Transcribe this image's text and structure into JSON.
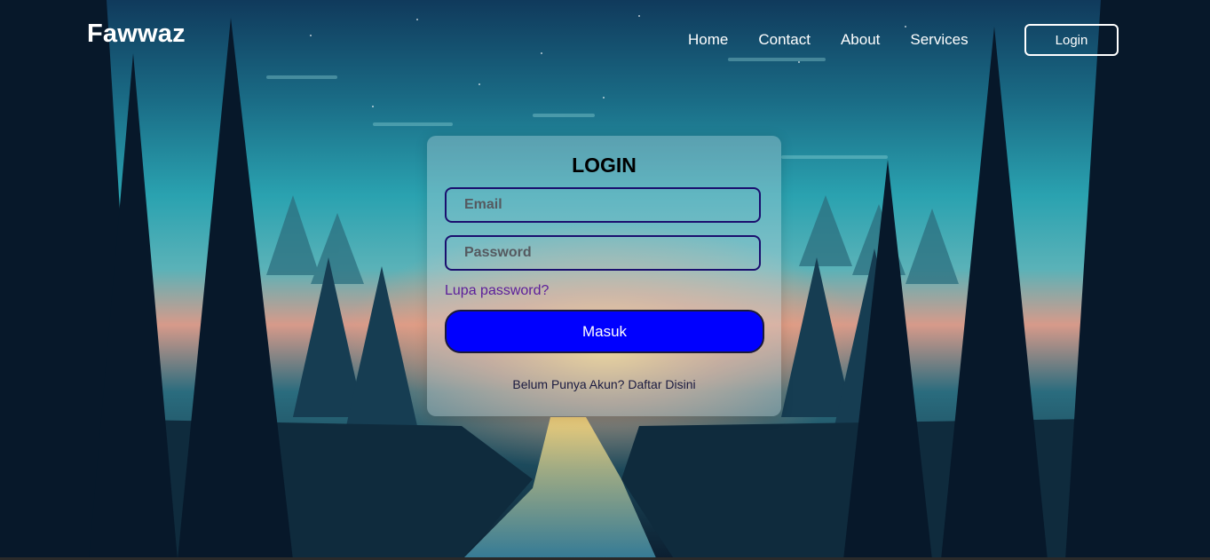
{
  "header": {
    "brand": "Fawwaz",
    "nav": [
      "Home",
      "Contact",
      "About",
      "Services"
    ],
    "login_button": "Login"
  },
  "login_card": {
    "title": "LOGIN",
    "email_placeholder": "Email",
    "password_placeholder": "Password",
    "forgot_link": "Lupa password?",
    "submit_label": "Masuk",
    "register_prompt": "Belum Punya Akun?",
    "register_link": "Daftar Disini"
  },
  "colors": {
    "submit_button": "#0000ff",
    "input_border": "#1a0f6e",
    "forgot_link": "#5b1d9a",
    "text_white": "#ffffff"
  }
}
